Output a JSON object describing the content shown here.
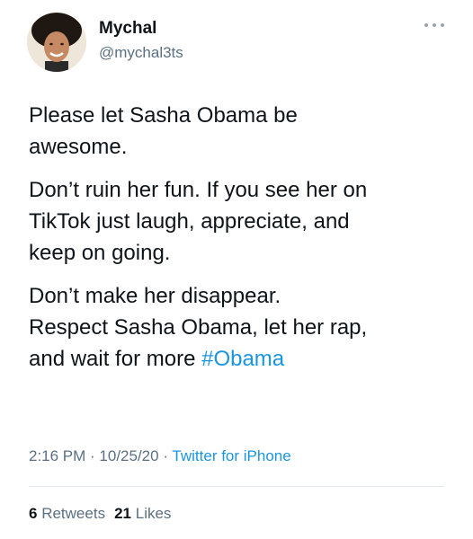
{
  "user": {
    "name": "Mychal",
    "handle": "@mychal3ts"
  },
  "tweet": {
    "paragraph_1": "Please let Sasha Obama be\nawesome.",
    "paragraph_2": "Don’t ruin her fun. If you see her on\nTikTok just laugh, appreciate, and\nkeep on going.",
    "paragraph_3_text": "Don’t make her disappear.\nRespect Sasha Obama, let her rap,\nand wait for more ",
    "hashtag": "#Obama"
  },
  "meta": {
    "time": "2:16 PM",
    "separator_1": " · ",
    "date": "10/25/20",
    "separator_2": " · ",
    "source": "Twitter for iPhone"
  },
  "stats": {
    "retweets_count": "6",
    "retweets_label": "Retweets",
    "likes_count": "21",
    "likes_label": "Likes"
  },
  "icons": {
    "more": "more-options-icon",
    "avatar": "profile-avatar"
  },
  "colors": {
    "link": "#1b95e0",
    "secondary_text": "#5b7083",
    "primary_text": "#0f1419",
    "divider": "#e3e8ec"
  }
}
